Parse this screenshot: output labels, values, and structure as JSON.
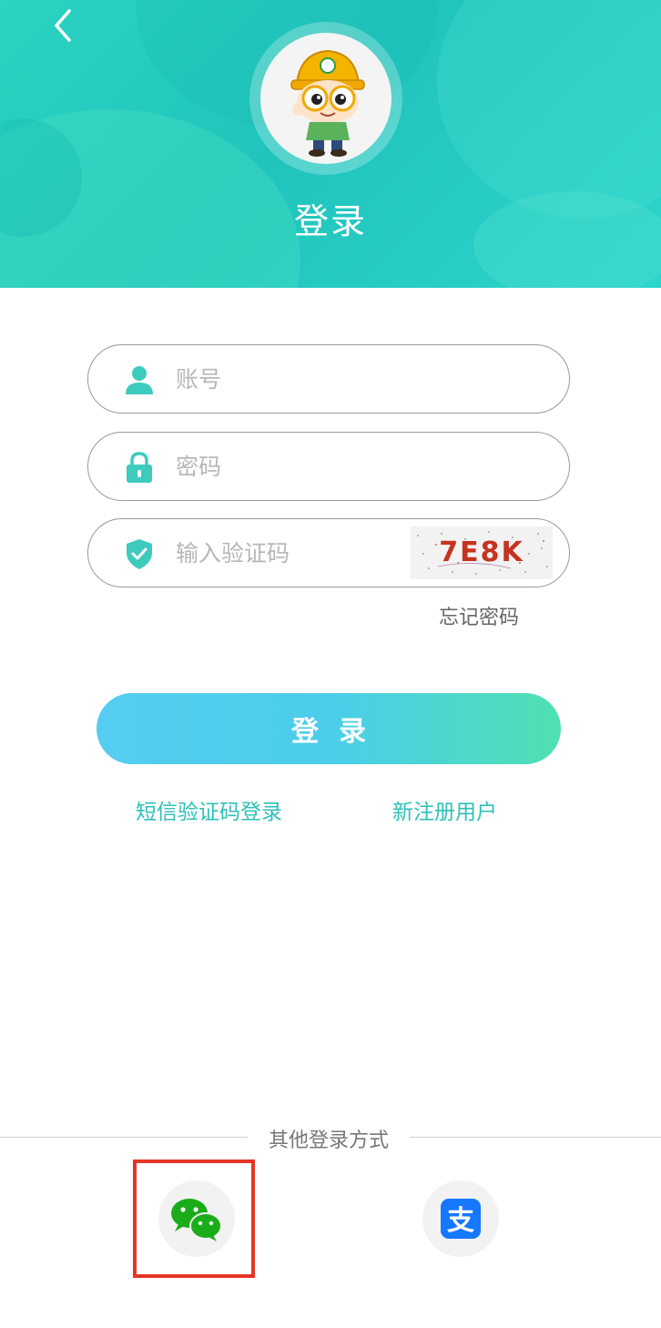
{
  "header": {
    "title": "登录"
  },
  "form": {
    "account_placeholder": "账号",
    "password_placeholder": "密码",
    "captcha_placeholder": "输入验证码",
    "captcha_code": "7E8K",
    "forgot_password": "忘记密码",
    "login_button": "登录",
    "sms_login": "短信验证码登录",
    "register": "新注册用户"
  },
  "other_login": {
    "label": "其他登录方式",
    "wechat_icon": "wechat-icon",
    "alipay_icon": "alipay-icon"
  },
  "colors": {
    "header_teal": "#21c4bc",
    "icon_teal": "#3ecbbd",
    "link_teal": "#2ec0b8",
    "button_start": "#55cdf0",
    "button_end": "#4ee0b2",
    "captcha_red": "#c6331f",
    "highlight_red": "#e53525",
    "wechat_green": "#1aad19",
    "alipay_blue": "#1677ff"
  }
}
